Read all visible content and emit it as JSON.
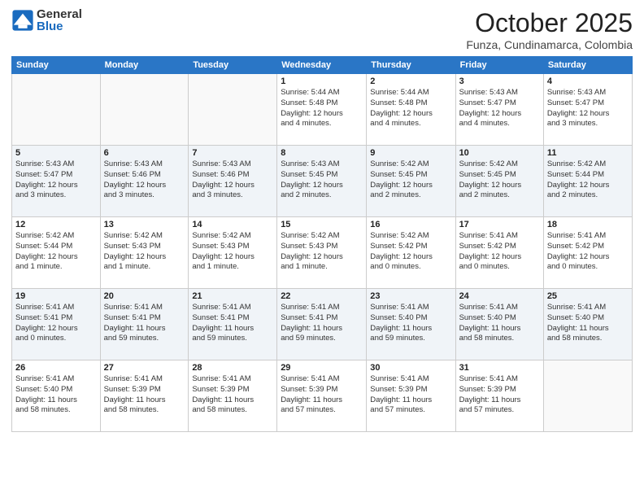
{
  "header": {
    "logo_general": "General",
    "logo_blue": "Blue",
    "month": "October 2025",
    "location": "Funza, Cundinamarca, Colombia"
  },
  "weekdays": [
    "Sunday",
    "Monday",
    "Tuesday",
    "Wednesday",
    "Thursday",
    "Friday",
    "Saturday"
  ],
  "weeks": [
    [
      {
        "day": "",
        "info": ""
      },
      {
        "day": "",
        "info": ""
      },
      {
        "day": "",
        "info": ""
      },
      {
        "day": "1",
        "info": "Sunrise: 5:44 AM\nSunset: 5:48 PM\nDaylight: 12 hours\nand 4 minutes."
      },
      {
        "day": "2",
        "info": "Sunrise: 5:44 AM\nSunset: 5:48 PM\nDaylight: 12 hours\nand 4 minutes."
      },
      {
        "day": "3",
        "info": "Sunrise: 5:43 AM\nSunset: 5:47 PM\nDaylight: 12 hours\nand 4 minutes."
      },
      {
        "day": "4",
        "info": "Sunrise: 5:43 AM\nSunset: 5:47 PM\nDaylight: 12 hours\nand 3 minutes."
      }
    ],
    [
      {
        "day": "5",
        "info": "Sunrise: 5:43 AM\nSunset: 5:47 PM\nDaylight: 12 hours\nand 3 minutes."
      },
      {
        "day": "6",
        "info": "Sunrise: 5:43 AM\nSunset: 5:46 PM\nDaylight: 12 hours\nand 3 minutes."
      },
      {
        "day": "7",
        "info": "Sunrise: 5:43 AM\nSunset: 5:46 PM\nDaylight: 12 hours\nand 3 minutes."
      },
      {
        "day": "8",
        "info": "Sunrise: 5:43 AM\nSunset: 5:45 PM\nDaylight: 12 hours\nand 2 minutes."
      },
      {
        "day": "9",
        "info": "Sunrise: 5:42 AM\nSunset: 5:45 PM\nDaylight: 12 hours\nand 2 minutes."
      },
      {
        "day": "10",
        "info": "Sunrise: 5:42 AM\nSunset: 5:45 PM\nDaylight: 12 hours\nand 2 minutes."
      },
      {
        "day": "11",
        "info": "Sunrise: 5:42 AM\nSunset: 5:44 PM\nDaylight: 12 hours\nand 2 minutes."
      }
    ],
    [
      {
        "day": "12",
        "info": "Sunrise: 5:42 AM\nSunset: 5:44 PM\nDaylight: 12 hours\nand 1 minute."
      },
      {
        "day": "13",
        "info": "Sunrise: 5:42 AM\nSunset: 5:43 PM\nDaylight: 12 hours\nand 1 minute."
      },
      {
        "day": "14",
        "info": "Sunrise: 5:42 AM\nSunset: 5:43 PM\nDaylight: 12 hours\nand 1 minute."
      },
      {
        "day": "15",
        "info": "Sunrise: 5:42 AM\nSunset: 5:43 PM\nDaylight: 12 hours\nand 1 minute."
      },
      {
        "day": "16",
        "info": "Sunrise: 5:42 AM\nSunset: 5:42 PM\nDaylight: 12 hours\nand 0 minutes."
      },
      {
        "day": "17",
        "info": "Sunrise: 5:41 AM\nSunset: 5:42 PM\nDaylight: 12 hours\nand 0 minutes."
      },
      {
        "day": "18",
        "info": "Sunrise: 5:41 AM\nSunset: 5:42 PM\nDaylight: 12 hours\nand 0 minutes."
      }
    ],
    [
      {
        "day": "19",
        "info": "Sunrise: 5:41 AM\nSunset: 5:41 PM\nDaylight: 12 hours\nand 0 minutes."
      },
      {
        "day": "20",
        "info": "Sunrise: 5:41 AM\nSunset: 5:41 PM\nDaylight: 11 hours\nand 59 minutes."
      },
      {
        "day": "21",
        "info": "Sunrise: 5:41 AM\nSunset: 5:41 PM\nDaylight: 11 hours\nand 59 minutes."
      },
      {
        "day": "22",
        "info": "Sunrise: 5:41 AM\nSunset: 5:41 PM\nDaylight: 11 hours\nand 59 minutes."
      },
      {
        "day": "23",
        "info": "Sunrise: 5:41 AM\nSunset: 5:40 PM\nDaylight: 11 hours\nand 59 minutes."
      },
      {
        "day": "24",
        "info": "Sunrise: 5:41 AM\nSunset: 5:40 PM\nDaylight: 11 hours\nand 58 minutes."
      },
      {
        "day": "25",
        "info": "Sunrise: 5:41 AM\nSunset: 5:40 PM\nDaylight: 11 hours\nand 58 minutes."
      }
    ],
    [
      {
        "day": "26",
        "info": "Sunrise: 5:41 AM\nSunset: 5:40 PM\nDaylight: 11 hours\nand 58 minutes."
      },
      {
        "day": "27",
        "info": "Sunrise: 5:41 AM\nSunset: 5:39 PM\nDaylight: 11 hours\nand 58 minutes."
      },
      {
        "day": "28",
        "info": "Sunrise: 5:41 AM\nSunset: 5:39 PM\nDaylight: 11 hours\nand 58 minutes."
      },
      {
        "day": "29",
        "info": "Sunrise: 5:41 AM\nSunset: 5:39 PM\nDaylight: 11 hours\nand 57 minutes."
      },
      {
        "day": "30",
        "info": "Sunrise: 5:41 AM\nSunset: 5:39 PM\nDaylight: 11 hours\nand 57 minutes."
      },
      {
        "day": "31",
        "info": "Sunrise: 5:41 AM\nSunset: 5:39 PM\nDaylight: 11 hours\nand 57 minutes."
      },
      {
        "day": "",
        "info": ""
      }
    ]
  ]
}
